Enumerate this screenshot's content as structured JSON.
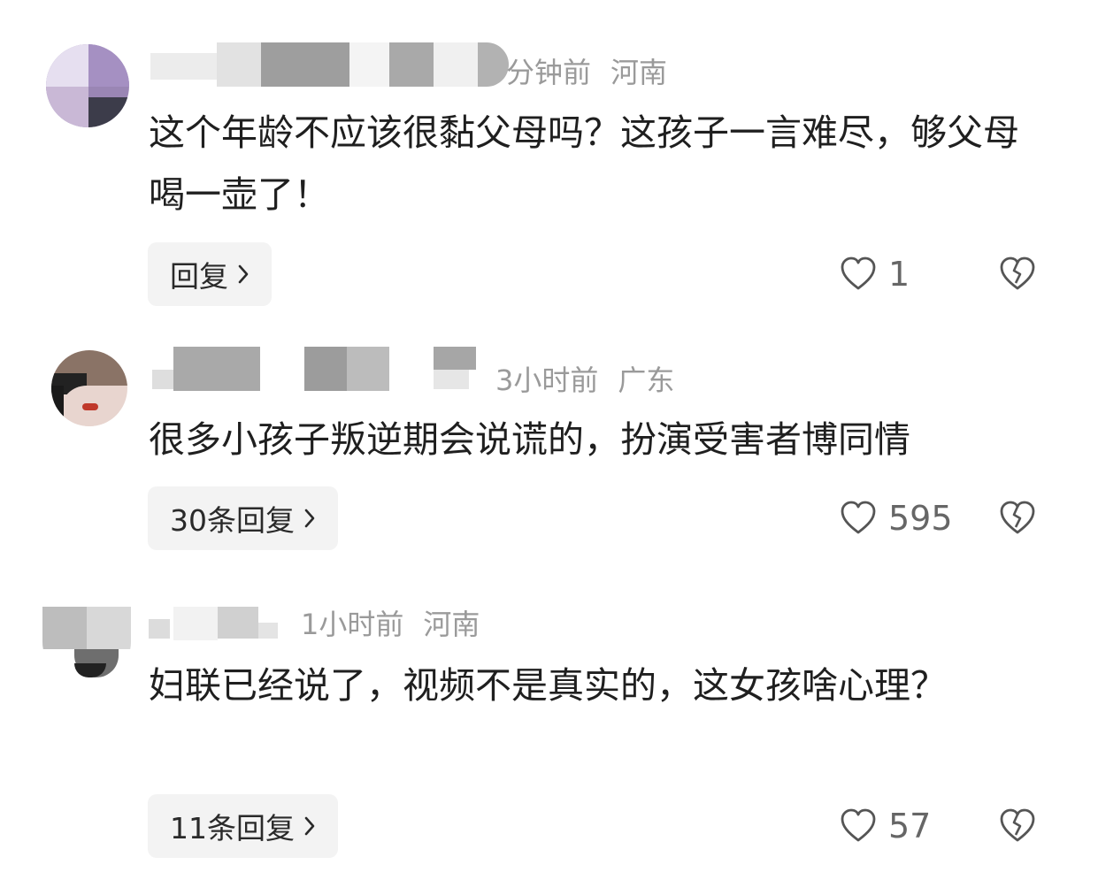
{
  "comments": [
    {
      "time": "分钟前",
      "location": "河南",
      "text": "这个年龄不应该很黏父母吗？这孩子一言难尽，够父母喝一壶了！",
      "reply_label": "回复",
      "likes": "1",
      "avatar_colors": [
        "#c9b8d6",
        "#9a86b4",
        "#3c3c4a",
        "#e6dff0"
      ]
    },
    {
      "time": "3小时前",
      "location": "广东",
      "text": "很多小孩子叛逆期会说谎的，扮演受害者博同情",
      "reply_label": "30条回复",
      "likes": "595",
      "avatar_colors": [
        "#8a7366",
        "#c9a898",
        "#1a1a1a",
        "#e8d5cf"
      ]
    },
    {
      "time": "1小时前",
      "location": "河南",
      "text": "妇联已经说了，视频不是真实的，这女孩啥心理？",
      "reply_label": "11条回复",
      "likes": "57",
      "avatar_colors": [
        "#bdbdbd",
        "#d8d8d8",
        "#222222",
        "#6e6e6e"
      ]
    }
  ],
  "icons": {
    "like": "heart-outline-icon",
    "dislike": "broken-heart-icon",
    "reply": "chevron-right-icon"
  },
  "colors": {
    "meta_text": "#9a9a9a",
    "body_text": "#1f1f1f",
    "button_bg": "#f3f3f3",
    "icon_stroke": "#555555"
  }
}
